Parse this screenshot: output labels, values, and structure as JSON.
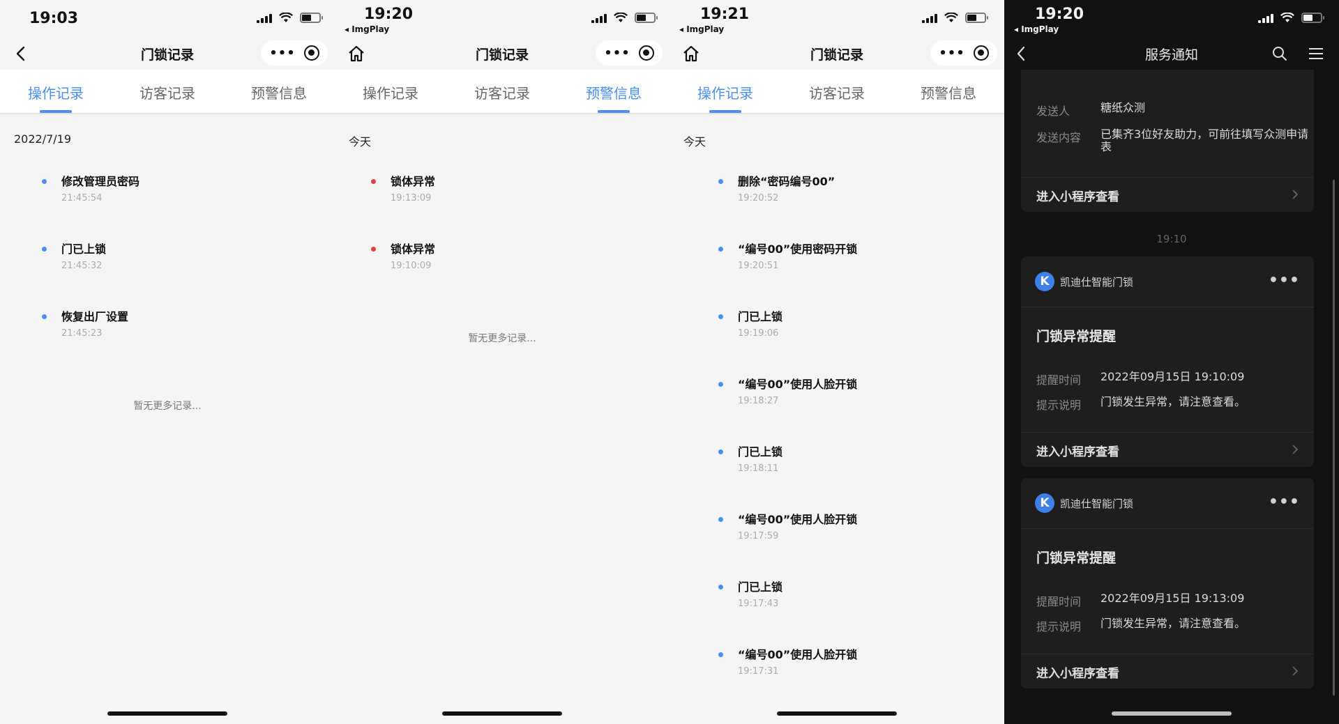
{
  "panels": [
    {
      "status_time": "19:03",
      "title": "门锁记录",
      "tabs": [
        "操作记录",
        "访客记录",
        "预警信息"
      ],
      "active_tab": 0,
      "date": "2022/7/19",
      "records": [
        {
          "title": "修改管理员密码",
          "time": "21:45:54"
        },
        {
          "title": "门已上锁",
          "time": "21:45:32"
        },
        {
          "title": "恢复出厂设置",
          "time": "21:45:23"
        }
      ],
      "no_more": "暂无更多记录..."
    },
    {
      "status_time": "19:20",
      "back_app": "◂ ImgPlay",
      "title": "门锁记录",
      "tabs": [
        "操作记录",
        "访客记录",
        "预警信息"
      ],
      "active_tab": 2,
      "date": "今天",
      "records": [
        {
          "title": "锁体异常",
          "time": "19:13:09"
        },
        {
          "title": "锁体异常",
          "time": "19:10:09"
        }
      ],
      "no_more": "暂无更多记录..."
    },
    {
      "status_time": "19:21",
      "back_app": "◂ ImgPlay",
      "title": "门锁记录",
      "tabs": [
        "操作记录",
        "访客记录",
        "预警信息"
      ],
      "active_tab": 0,
      "date": "今天",
      "records": [
        {
          "title": "删除“密码编号00”",
          "time": "19:20:52"
        },
        {
          "title": "“编号00”使用密码开锁",
          "time": "19:20:51"
        },
        {
          "title": "门已上锁",
          "time": "19:19:06"
        },
        {
          "title": "“编号00”使用人脸开锁",
          "time": "19:18:27"
        },
        {
          "title": "门已上锁",
          "time": "19:18:11"
        },
        {
          "title": "“编号00”使用人脸开锁",
          "time": "19:17:59"
        },
        {
          "title": "门已上锁",
          "time": "19:17:43"
        },
        {
          "title": "“编号00”使用人脸开锁",
          "time": "19:17:31"
        }
      ]
    }
  ],
  "notify": {
    "status_time": "19:20",
    "back_app": "◂ ImgPlay",
    "title": "服务通知",
    "top_card": {
      "sender_label": "发送人",
      "sender": "糖纸众测",
      "content_label": "发送内容",
      "content": "已集齐3位好友助力，可前往填写众测申请表",
      "enter": "进入小程序查看"
    },
    "timestamp": "19:10",
    "cards": [
      {
        "brand": "凯迪仕智能门锁",
        "logo": "K",
        "title": "门锁异常提醒",
        "time_label": "提醒时间",
        "time": "2022年09月15日 19:10:09",
        "desc_label": "提示说明",
        "desc": "门锁发生异常，请注意查看。",
        "enter": "进入小程序查看"
      },
      {
        "brand": "凯迪仕智能门锁",
        "logo": "K",
        "title": "门锁异常提醒",
        "time_label": "提醒时间",
        "time": "2022年09月15日 19:13:09",
        "desc_label": "提示说明",
        "desc": "门锁发生异常，请注意查看。",
        "enter": "进入小程序查看"
      }
    ]
  },
  "colors": {
    "accent": "#4a8ff0",
    "alert_dot": "#e5413f",
    "dark_bg": "#111111",
    "card_bg": "#1e1e1e"
  },
  "icons": [
    "back-icon",
    "home-icon",
    "more-icon",
    "close-capsule-icon",
    "search-icon",
    "menu-icon",
    "chevron-right-icon",
    "signal-icon",
    "wifi-icon",
    "battery-icon"
  ]
}
